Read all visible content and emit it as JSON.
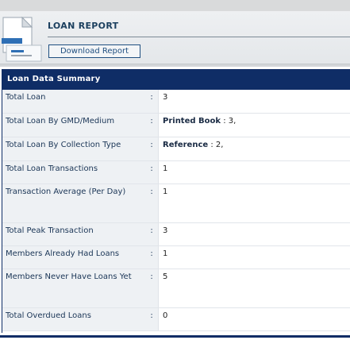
{
  "header": {
    "title": "LOAN REPORT",
    "download_label": "Download Report"
  },
  "summary": {
    "title": "Loan Data Summary",
    "separator": ":",
    "rows": [
      {
        "label": "Total Loan",
        "value": "3"
      },
      {
        "label": "Total Loan By GMD/Medium",
        "value_strong": "Printed Book",
        "value_rest": " : 3,"
      },
      {
        "label": "Total Loan By Collection Type",
        "value_strong": "Reference",
        "value_rest": " : 2,"
      },
      {
        "label": "Total Loan Transactions",
        "value": "1"
      },
      {
        "label": "Transaction Average (Per Day)",
        "value": "1"
      },
      {
        "label": "Total Peak Transaction",
        "value": "3"
      },
      {
        "label": "Members Already Had Loans",
        "value": "1"
      },
      {
        "label": "Members Never Have Loans Yet",
        "value": "5"
      },
      {
        "label": "Total Overdued Loans",
        "value": "0"
      }
    ]
  },
  "colors": {
    "accent": "#0f2d66",
    "label_bg": "#eef1f4",
    "title_text": "#1b3f5e"
  }
}
